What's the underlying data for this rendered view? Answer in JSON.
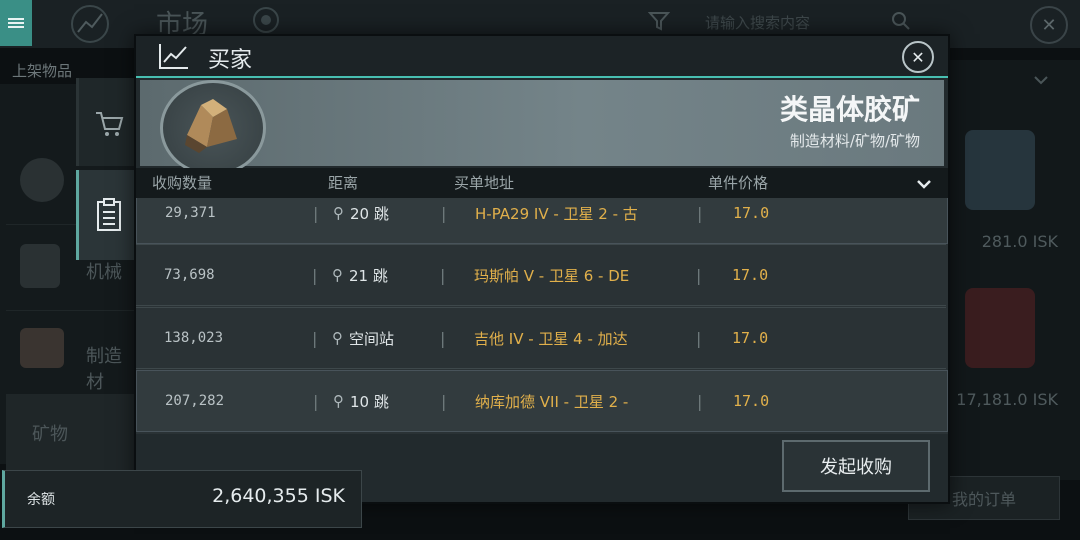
{
  "background": {
    "title": "市场",
    "search_placeholder": "请输入搜索内容",
    "listed_label": "上架物品",
    "categories": [
      "机械",
      "制造材",
      "矿物"
    ],
    "prices": [
      "281.0 ISK",
      "17,181.0 ISK"
    ],
    "orders_button": "我的订单"
  },
  "dialog": {
    "title": "买家",
    "item": {
      "name": "类晶体胶矿",
      "category": "制造材料/矿物/矿物"
    },
    "columns": [
      "收购数量",
      "距离",
      "买单地址",
      "单件价格"
    ],
    "rows": [
      {
        "qty": "29,371",
        "distance": "20 跳",
        "location": "H-PA29 IV - 卫星 2 - 古",
        "price": "17.0"
      },
      {
        "qty": "73,698",
        "distance": "21 跳",
        "location": "玛斯帕 V - 卫星 6 - DE",
        "price": "17.0"
      },
      {
        "qty": "138,023",
        "distance": "空间站",
        "location": "吉他 IV - 卫星 4 - 加达",
        "price": "17.0"
      },
      {
        "qty": "207,282",
        "distance": "10 跳",
        "location": "纳库加德 VII - 卫星 2 -",
        "price": "17.0"
      }
    ],
    "buy_button": "发起收购"
  },
  "balance": {
    "label": "余额",
    "value": "2,640,355 ISK"
  },
  "colors": {
    "accent": "#48bfb1",
    "price": "#e1b04b"
  }
}
